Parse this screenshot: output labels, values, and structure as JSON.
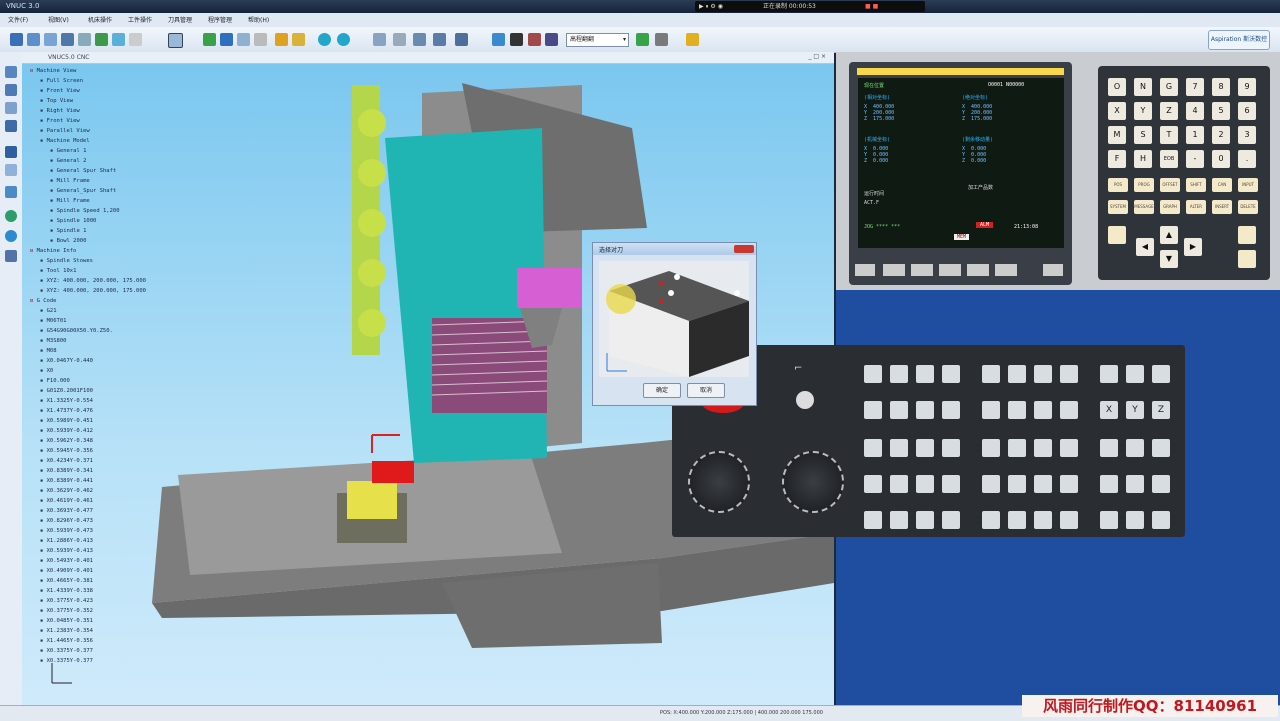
{
  "title_bar": {
    "title": "VNUC 3.0",
    "recorder_text": "正在录制 00:00:53"
  },
  "menu": [
    "文件(F)",
    "视图(V)",
    "机床操作",
    "工件操作",
    "刀具管理",
    "程序管理",
    "帮助(H)"
  ],
  "toolbar": {
    "mode_select": "高程翻翻",
    "brand": "Aspiration 斯沃数控"
  },
  "viewport": {
    "title": "VNUC5.0 CNC"
  },
  "tree": [
    {
      "label": "Machine View",
      "level": 0
    },
    {
      "label": "Full Screen",
      "level": 1
    },
    {
      "label": "Front View",
      "level": 1
    },
    {
      "label": "Top View",
      "level": 1
    },
    {
      "label": "Right View",
      "level": 1
    },
    {
      "label": "Front View",
      "level": 1
    },
    {
      "label": "Parallel View",
      "level": 1
    },
    {
      "label": "Machine Model",
      "level": 1
    },
    {
      "label": "General 1",
      "level": 2
    },
    {
      "label": "General 2",
      "level": 2
    },
    {
      "label": "General Spur Shaft",
      "level": 2
    },
    {
      "label": "Mill Frame",
      "level": 2
    },
    {
      "label": "General_Spur Shaft",
      "level": 2
    },
    {
      "label": "Mill Frame",
      "level": 2
    },
    {
      "label": "Spindle Speed 1,200",
      "level": 2
    },
    {
      "label": "Spindle 1000",
      "level": 2
    },
    {
      "label": "Spindle 1",
      "level": 2
    },
    {
      "label": "Bowl 2000",
      "level": 2
    },
    {
      "label": "Machine Info",
      "level": 0
    },
    {
      "label": "Spindle Stowes",
      "level": 1
    },
    {
      "label": "Tool 10x1",
      "level": 1
    },
    {
      "label": "XYZ: 400.000, 200.000, 175.000",
      "level": 1
    },
    {
      "label": "XYZ: 400.000, 200.000, 175.000",
      "level": 1
    },
    {
      "label": "G Code",
      "level": 0
    },
    {
      "label": "G21",
      "level": 1
    },
    {
      "label": "M06T01",
      "level": 1
    },
    {
      "label": "G54G90G00X50.Y0.Z50.",
      "level": 1
    },
    {
      "label": "M3S800",
      "level": 1
    },
    {
      "label": "M08",
      "level": 1
    },
    {
      "label": "X0.0467Y-0.440",
      "level": 1
    },
    {
      "label": "X0",
      "level": 1
    },
    {
      "label": "F10.000",
      "level": 1
    },
    {
      "label": "G01Z0.2001F100",
      "level": 1
    },
    {
      "label": "X1.3325Y-0.554",
      "level": 1
    },
    {
      "label": "X1.4737Y-0.476",
      "level": 1
    },
    {
      "label": "X0.5989Y-0.451",
      "level": 1
    },
    {
      "label": "X0.5939Y-0.412",
      "level": 1
    },
    {
      "label": "X0.5962Y-0.348",
      "level": 1
    },
    {
      "label": "X0.5945Y-0.356",
      "level": 1
    },
    {
      "label": "X0.4234Y-0.371",
      "level": 1
    },
    {
      "label": "X0.8389Y-0.341",
      "level": 1
    },
    {
      "label": "X0.8389Y-0.441",
      "level": 1
    },
    {
      "label": "X0.3629Y-0.462",
      "level": 1
    },
    {
      "label": "X0.4619Y-0.461",
      "level": 1
    },
    {
      "label": "X0.3693Y-0.477",
      "level": 1
    },
    {
      "label": "X0.8296Y-0.473",
      "level": 1
    },
    {
      "label": "X0.5939Y-0.473",
      "level": 1
    },
    {
      "label": "X1.2886Y-0.413",
      "level": 1
    },
    {
      "label": "X0.5939Y-0.413",
      "level": 1
    },
    {
      "label": "X0.5493Y-0.401",
      "level": 1
    },
    {
      "label": "X0.4909Y-0.401",
      "level": 1
    },
    {
      "label": "X0.4665Y-0.381",
      "level": 1
    },
    {
      "label": "X1.4339Y-0.338",
      "level": 1
    },
    {
      "label": "X0.3775Y-0.423",
      "level": 1
    },
    {
      "label": "X0.3775Y-0.352",
      "level": 1
    },
    {
      "label": "X0.0485Y-0.351",
      "level": 1
    },
    {
      "label": "X1.2383Y-0.354",
      "level": 1
    },
    {
      "label": "X1.4465Y-0.356",
      "level": 1
    },
    {
      "label": "X0.3375Y-0.377",
      "level": 1
    },
    {
      "label": "X0.3375Y-0.377",
      "level": 1
    }
  ],
  "cnc_screen": {
    "header": "现在位置",
    "program": "O0001 N00000",
    "relative_title": "(相对坐标)",
    "absolute_title": "(绝对坐标)",
    "machine_title": "(机械坐标)",
    "remain_title": "(剩余移动量)",
    "rel": [
      [
        "X",
        "400.000"
      ],
      [
        "Y",
        "200.000"
      ],
      [
        "Z",
        "175.000"
      ]
    ],
    "abs": [
      [
        "X",
        "400.000"
      ],
      [
        "Y",
        "200.000"
      ],
      [
        "Z",
        "175.000"
      ]
    ],
    "mach": [
      [
        "X",
        "0.000"
      ],
      [
        "Y",
        "0.000"
      ],
      [
        "Z",
        "0.000"
      ]
    ],
    "remain": [
      [
        "X",
        "0.000"
      ],
      [
        "Y",
        "0.000"
      ],
      [
        "Z",
        "0.000"
      ]
    ],
    "run_time": "运行时间",
    "parts": "加工产品数",
    "act_f": "ACT.F",
    "status_line": "JOG **** ***",
    "alarm": "ALM",
    "time": "21:13:08",
    "mode": "MEM"
  },
  "keypad": {
    "keys": [
      "O",
      "N",
      "G",
      "7",
      "8",
      "9",
      "X",
      "Y",
      "Z",
      "4",
      "5",
      "6",
      "M",
      "S",
      "T",
      "1",
      "2",
      "3",
      "F",
      "H",
      "EOB",
      "-",
      "0",
      "."
    ],
    "soft": [
      "POS",
      "PROG",
      "OFFSET",
      "SHIFT",
      "CAN",
      "INPUT",
      "SYSTEM",
      "MESSAGE",
      "GRAPH",
      "ALTER",
      "INSERT",
      "DELETE"
    ]
  },
  "dialog": {
    "title": "选择对刀",
    "ok": "确定",
    "cancel": "取消"
  },
  "status_bar": {
    "text": "POS: X:400.000 Y:200.000 Z:175.000 | 400.000 200.000 175.000"
  },
  "watermark": "风雨同行制作QQ：81140961",
  "colors": {
    "viewport_sky": "#79c6ef",
    "cnc_blue": "#1f4ea1",
    "teal": "#20b5b3",
    "gray_machine": "#8a8a8a"
  }
}
